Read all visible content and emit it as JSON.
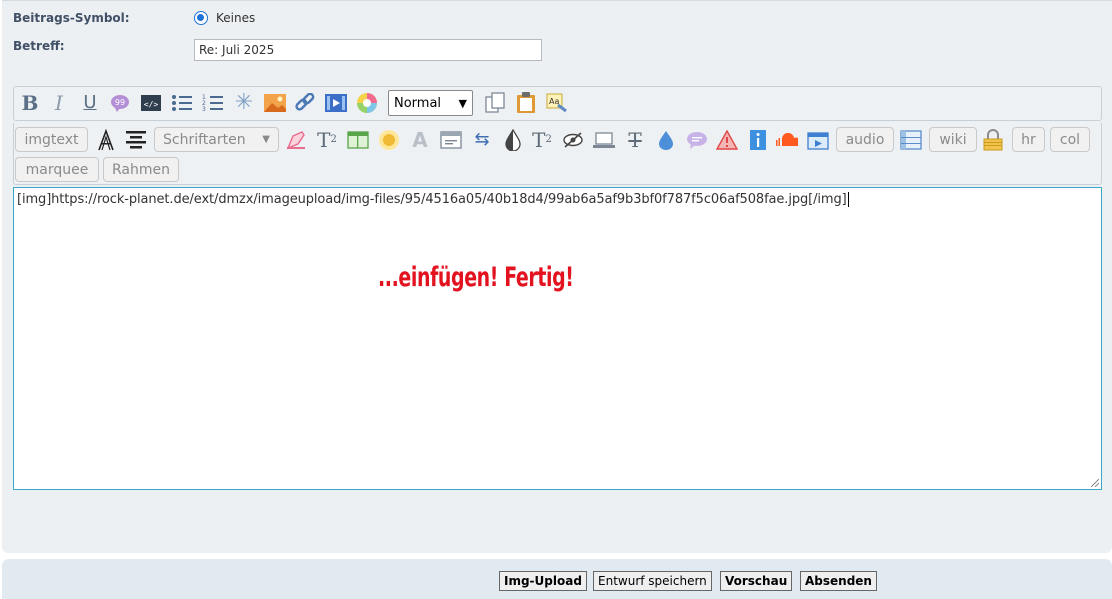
{
  "form": {
    "symbol_label": "Beitrags-Symbol:",
    "symbol_option": "Keines",
    "subject_label": "Betreff:",
    "subject_value": "Re: Juli 2025"
  },
  "toolbar": {
    "font_size_select": "Normal",
    "row2_buttons": {
      "imgtext": "imgtext",
      "schriftarten": "Schriftarten",
      "audio": "audio",
      "wiki": "wiki",
      "hr": "hr",
      "col": "col",
      "marquee": "marquee",
      "rahmen": "Rahmen"
    }
  },
  "editor": {
    "content": "[img]https://rock-planet.de/ext/dmzx/imageupload/img-files/95/4516a05/40b18d4/99ab6a5af9b3bf0f787f5c06af508fae.jpg[/img]",
    "overlay_text": "...einfügen! Fertig!"
  },
  "footer": {
    "img_upload": "Img-Upload",
    "save_draft": "Entwurf speichern",
    "preview": "Vorschau",
    "submit": "Absenden"
  },
  "colors": {
    "accent": "#1f73d6",
    "overlay_red": "#e3121f",
    "editor_border": "#3aa8c8"
  }
}
